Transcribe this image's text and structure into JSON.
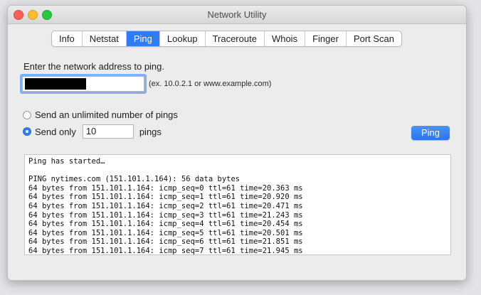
{
  "window": {
    "title": "Network Utility"
  },
  "tabs": [
    {
      "label": "Info",
      "active": false
    },
    {
      "label": "Netstat",
      "active": false
    },
    {
      "label": "Ping",
      "active": true
    },
    {
      "label": "Lookup",
      "active": false
    },
    {
      "label": "Traceroute",
      "active": false
    },
    {
      "label": "Whois",
      "active": false
    },
    {
      "label": "Finger",
      "active": false
    },
    {
      "label": "Port Scan",
      "active": false
    }
  ],
  "ping": {
    "prompt": "Enter the network address to ping.",
    "address_value": "",
    "address_hint": "(ex. 10.0.2.1 or www.example.com)",
    "option_unlimited": "Send an unlimited number of pings",
    "option_send_only": "Send only",
    "count_value": "10",
    "count_suffix": "pings",
    "button_label": "Ping",
    "selected_option": "send_only"
  },
  "output": {
    "lines": [
      "Ping has started…",
      "",
      "PING nytimes.com (151.101.1.164): 56 data bytes",
      "64 bytes from 151.101.1.164: icmp_seq=0 ttl=61 time=20.363 ms",
      "64 bytes from 151.101.1.164: icmp_seq=1 ttl=61 time=20.920 ms",
      "64 bytes from 151.101.1.164: icmp_seq=2 ttl=61 time=20.471 ms",
      "64 bytes from 151.101.1.164: icmp_seq=3 ttl=61 time=21.243 ms",
      "64 bytes from 151.101.1.164: icmp_seq=4 ttl=61 time=20.454 ms",
      "64 bytes from 151.101.1.164: icmp_seq=5 ttl=61 time=20.501 ms",
      "64 bytes from 151.101.1.164: icmp_seq=6 ttl=61 time=21.851 ms",
      "64 bytes from 151.101.1.164: icmp_seq=7 ttl=61 time=21.945 ms"
    ]
  },
  "colors": {
    "accent": "#2f7cf6",
    "close": "#fe5f57",
    "minimize": "#febc2e",
    "maximize": "#28c840"
  }
}
